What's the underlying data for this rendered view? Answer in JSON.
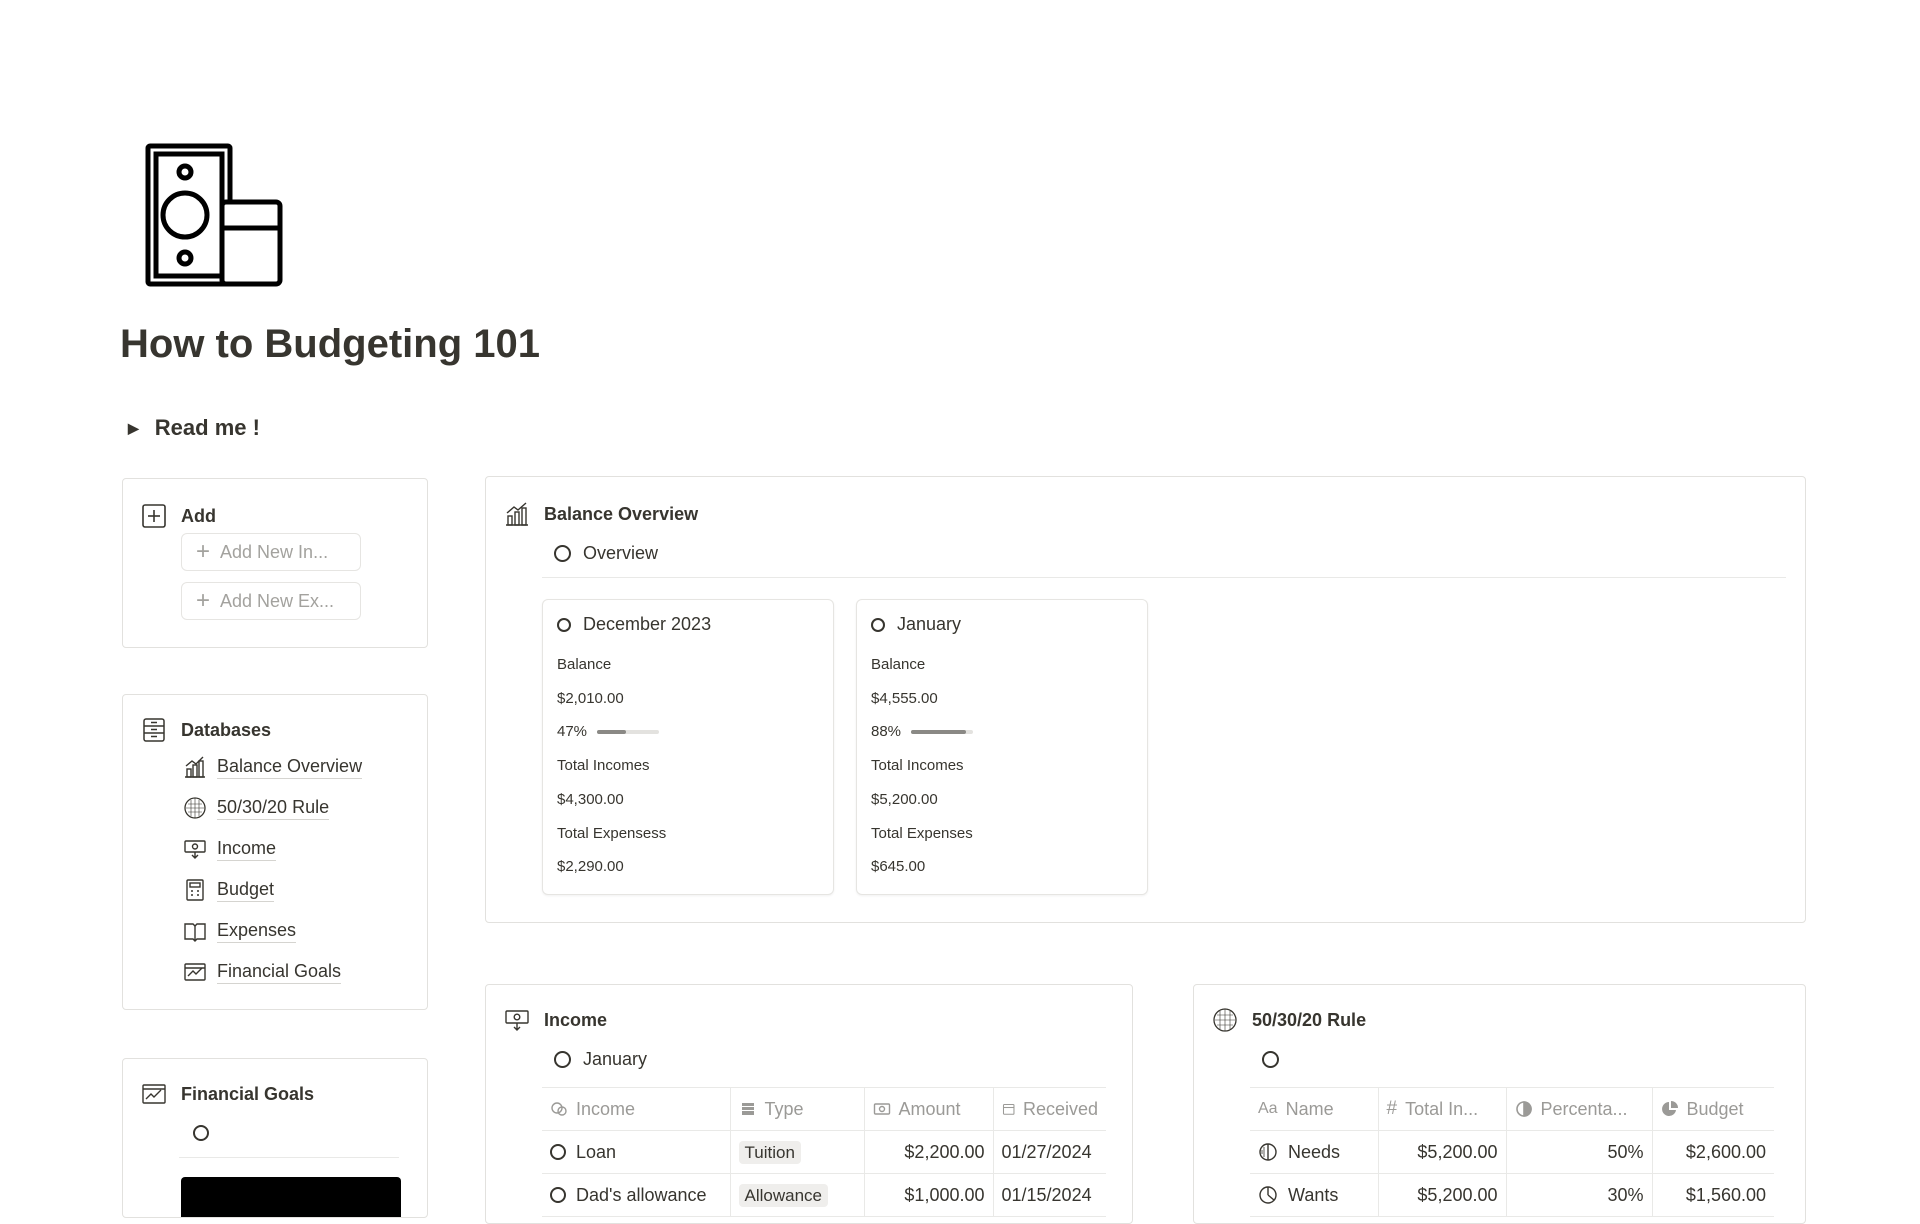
{
  "page": {
    "title": "How to Budgeting 101",
    "page_icon": "cash-card-icon",
    "toggle_label": "Read me !"
  },
  "add_panel": {
    "title": "Add",
    "buttons": [
      {
        "label": "Add New In...",
        "icon": "plus-icon"
      },
      {
        "label": "Add New Ex...",
        "icon": "plus-icon"
      }
    ]
  },
  "databases_panel": {
    "title": "Databases",
    "items": [
      {
        "label": "Balance Overview",
        "icon": "bar-chart-icon"
      },
      {
        "label": "50/30/20 Rule",
        "icon": "pie-chart-icon"
      },
      {
        "label": "Income",
        "icon": "cash-hand-icon"
      },
      {
        "label": "Budget",
        "icon": "calculator-icon"
      },
      {
        "label": "Expenses",
        "icon": "book-icon"
      },
      {
        "label": "Financial Goals",
        "icon": "goals-chart-icon"
      }
    ]
  },
  "financial_goals_panel": {
    "title": "Financial Goals"
  },
  "balance_overview": {
    "title": "Balance Overview",
    "view_label": "Overview",
    "cards": [
      {
        "title": "December 2023",
        "balance_label": "Balance",
        "balance": "$2,010.00",
        "percent": "47%",
        "percent_value": 47,
        "incomes_label": "Total Incomes",
        "incomes": "$4,300.00",
        "expenses_label": "Total Expensess",
        "expenses": "$2,290.00"
      },
      {
        "title": "January",
        "balance_label": "Balance",
        "balance": "$4,555.00",
        "percent": "88%",
        "percent_value": 88,
        "incomes_label": "Total Incomes",
        "incomes": "$5,200.00",
        "expenses_label": "Total Expenses",
        "expenses": "$645.00"
      }
    ]
  },
  "income": {
    "title": "Income",
    "view_label": "January",
    "columns": [
      "Income",
      "Type",
      "Amount",
      "Received"
    ],
    "rows": [
      {
        "name": "Loan",
        "type": "Tuition",
        "amount": "$2,200.00",
        "received": "01/27/2024"
      },
      {
        "name": "Dad's allowance",
        "type": "Allowance",
        "amount": "$1,000.00",
        "received": "01/15/2024"
      }
    ]
  },
  "rule": {
    "title": "50/30/20 Rule",
    "columns": [
      "Name",
      "Total In...",
      "Percenta...",
      "Budget"
    ],
    "name_prefix": "Aa",
    "rows": [
      {
        "name": "Needs",
        "total": "$5,200.00",
        "percent": "50%",
        "budget": "$2,600.00"
      },
      {
        "name": "Wants",
        "total": "$5,200.00",
        "percent": "30%",
        "budget": "$1,560.00"
      }
    ]
  }
}
